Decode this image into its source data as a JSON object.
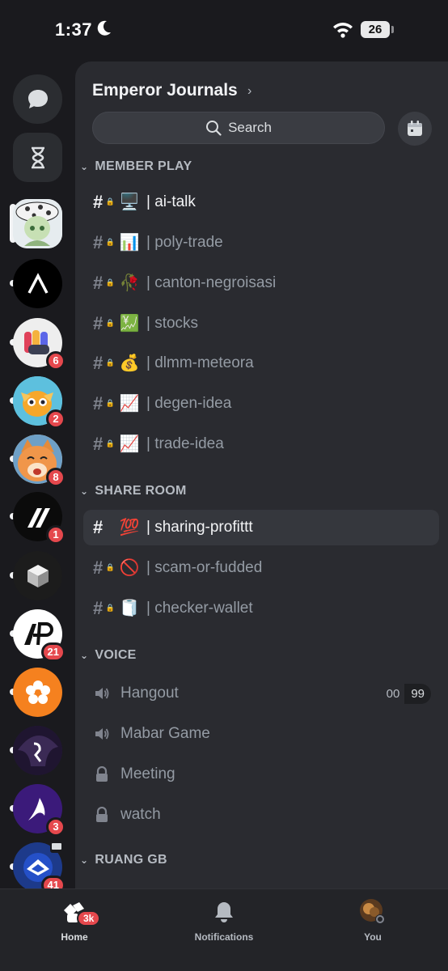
{
  "status_bar": {
    "time": "1:37",
    "battery": "26"
  },
  "guild": {
    "name": "Emperor Journals",
    "search_placeholder": "Search"
  },
  "categories": {
    "member_play": "MEMBER PLAY",
    "share_room": "SHARE ROOM",
    "voice": "VOICE",
    "ruang_gb": "RUANG GB"
  },
  "channels": [
    {
      "emoji": "🖥️",
      "name": "| ai-talk"
    },
    {
      "emoji": "📊",
      "name": "| poly-trade"
    },
    {
      "emoji": "🥀",
      "name": "| canton-negroisasi"
    },
    {
      "emoji": "💹",
      "name": "| stocks"
    },
    {
      "emoji": "💰",
      "name": "| dlmm-meteora"
    },
    {
      "emoji": "📈",
      "name": "| degen-idea"
    },
    {
      "emoji": "📈",
      "name": "| trade-idea"
    },
    {
      "emoji": "💯",
      "name": "| sharing-profittt"
    },
    {
      "emoji": "🚫",
      "name": "| scam-or-fudded"
    },
    {
      "emoji": "🧻",
      "name": "| checker-wallet"
    }
  ],
  "voice_channels": [
    {
      "name": "Hangout",
      "count_a": "00",
      "count_b": "99"
    },
    {
      "name": "Mabar Game"
    },
    {
      "name": "Meeting"
    },
    {
      "name": "watch"
    }
  ],
  "servers": [
    {
      "badge": ""
    },
    {
      "badge": ""
    },
    {
      "badge": "6"
    },
    {
      "badge": "2"
    },
    {
      "badge": "8"
    },
    {
      "badge": "1"
    },
    {
      "badge": ""
    },
    {
      "badge": "21"
    },
    {
      "badge": ""
    },
    {
      "badge": ""
    },
    {
      "badge": "3"
    },
    {
      "badge": "41"
    }
  ],
  "tabs": {
    "home": "Home",
    "home_badge": "3k",
    "notifications": "Notifications",
    "you": "You"
  },
  "colors": {
    "accent_red": "#e5484d",
    "panel": "#2a2b30",
    "rail": "#1a1a1e"
  }
}
